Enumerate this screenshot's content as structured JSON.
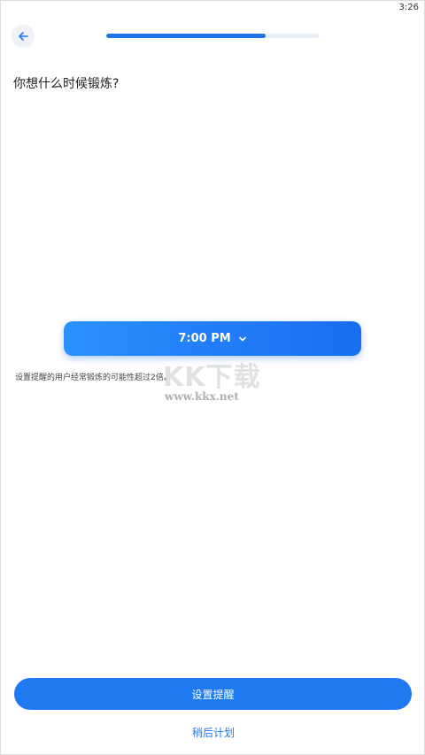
{
  "status_bar": {
    "time": "3:26"
  },
  "header": {
    "back_icon": "arrow-left-icon",
    "progress": 0.75
  },
  "main": {
    "question": "你想什么时候锻炼?",
    "time_selector": {
      "value": "7:00 PM",
      "icon": "chevron-down-icon"
    },
    "hint": "设置提醒的用户经常锻炼的可能性超过2倍。"
  },
  "watermark": {
    "logo": "KK下载",
    "url": "www.kkx.net"
  },
  "footer": {
    "primary_button": "设置提醒",
    "secondary_link": "稍后计划"
  },
  "colors": {
    "accent": "#1f7af2",
    "gradient_start": "#2a90ff",
    "gradient_end": "#1a6df0"
  }
}
